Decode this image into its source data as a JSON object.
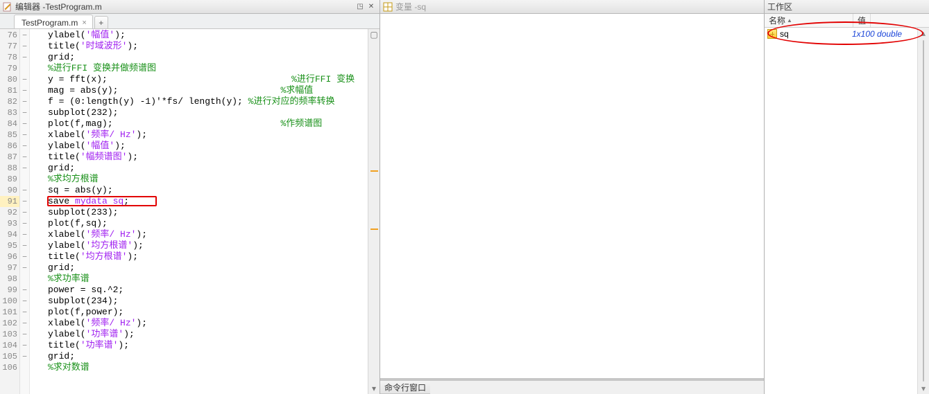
{
  "editor": {
    "title_prefix": "编辑器 - ",
    "title_file": "TestProgram.m",
    "tab_label": "TestProgram.m",
    "lines": [
      {
        "n": 76,
        "fold": true,
        "segs": [
          [
            "",
            "ylabel("
          ],
          [
            "str",
            "'幅值'"
          ],
          [
            "",
            ");"
          ]
        ]
      },
      {
        "n": 77,
        "fold": true,
        "segs": [
          [
            "",
            "title("
          ],
          [
            "str",
            "'时域波形'"
          ],
          [
            "",
            ");"
          ]
        ]
      },
      {
        "n": 78,
        "fold": true,
        "segs": [
          [
            "",
            "grid;"
          ]
        ]
      },
      {
        "n": 79,
        "fold": false,
        "segs": [
          [
            "cmt",
            "%进行FFI 变换并做频谱图"
          ]
        ]
      },
      {
        "n": 80,
        "fold": true,
        "segs": [
          [
            "",
            "y = fft(x);                                  "
          ],
          [
            "cmt",
            "%进行FFI 变换"
          ]
        ]
      },
      {
        "n": 81,
        "fold": true,
        "segs": [
          [
            "",
            "mag = abs(y);                              "
          ],
          [
            "cmt",
            "%求幅值"
          ]
        ]
      },
      {
        "n": 82,
        "fold": true,
        "segs": [
          [
            "",
            "f = (0:length(y) -1)'*fs/ length(y); "
          ],
          [
            "cmt",
            "%进行对应的频率转换"
          ]
        ]
      },
      {
        "n": 83,
        "fold": true,
        "segs": [
          [
            "",
            "subplot(232);"
          ]
        ]
      },
      {
        "n": 84,
        "fold": true,
        "segs": [
          [
            "",
            "plot(f,mag);                               "
          ],
          [
            "cmt",
            "%作频谱图"
          ]
        ]
      },
      {
        "n": 85,
        "fold": true,
        "segs": [
          [
            "",
            "xlabel("
          ],
          [
            "str",
            "'频率/ Hz'"
          ],
          [
            "",
            ");"
          ]
        ]
      },
      {
        "n": 86,
        "fold": true,
        "segs": [
          [
            "",
            "ylabel("
          ],
          [
            "str",
            "'幅值'"
          ],
          [
            "",
            ");"
          ]
        ]
      },
      {
        "n": 87,
        "fold": true,
        "segs": [
          [
            "",
            "title("
          ],
          [
            "str",
            "'幅频谱图'"
          ],
          [
            "",
            ");"
          ]
        ]
      },
      {
        "n": 88,
        "fold": true,
        "segs": [
          [
            "",
            "grid;"
          ]
        ]
      },
      {
        "n": 89,
        "fold": false,
        "segs": [
          [
            "cmt",
            "%求均方根谱"
          ]
        ]
      },
      {
        "n": 90,
        "fold": true,
        "segs": [
          [
            "",
            "sq = abs(y);"
          ]
        ]
      },
      {
        "n": 91,
        "fold": true,
        "segs": [
          [
            "",
            "save "
          ],
          [
            "str",
            "mydata sq"
          ],
          [
            "",
            ";"
          ]
        ]
      },
      {
        "n": 92,
        "fold": true,
        "segs": [
          [
            "",
            "subplot(233);"
          ]
        ]
      },
      {
        "n": 93,
        "fold": true,
        "segs": [
          [
            "",
            "plot(f,sq);"
          ]
        ]
      },
      {
        "n": 94,
        "fold": true,
        "segs": [
          [
            "",
            "xlabel("
          ],
          [
            "str",
            "'频率/ Hz'"
          ],
          [
            "",
            ");"
          ]
        ]
      },
      {
        "n": 95,
        "fold": true,
        "segs": [
          [
            "",
            "ylabel("
          ],
          [
            "str",
            "'均方根谱'"
          ],
          [
            "",
            ");"
          ]
        ]
      },
      {
        "n": 96,
        "fold": true,
        "segs": [
          [
            "",
            "title("
          ],
          [
            "str",
            "'均方根谱'"
          ],
          [
            "",
            ");"
          ]
        ]
      },
      {
        "n": 97,
        "fold": true,
        "segs": [
          [
            "",
            "grid;"
          ]
        ]
      },
      {
        "n": 98,
        "fold": false,
        "segs": [
          [
            "cmt",
            "%求功率谱"
          ]
        ]
      },
      {
        "n": 99,
        "fold": true,
        "segs": [
          [
            "",
            "power = sq.^2;"
          ]
        ]
      },
      {
        "n": 100,
        "fold": true,
        "segs": [
          [
            "",
            "subplot(234);"
          ]
        ]
      },
      {
        "n": 101,
        "fold": true,
        "segs": [
          [
            "",
            "plot(f,power);"
          ]
        ]
      },
      {
        "n": 102,
        "fold": true,
        "segs": [
          [
            "",
            "xlabel("
          ],
          [
            "str",
            "'频率/ Hz'"
          ],
          [
            "",
            ");"
          ]
        ]
      },
      {
        "n": 103,
        "fold": true,
        "segs": [
          [
            "",
            "ylabel("
          ],
          [
            "str",
            "'功率谱'"
          ],
          [
            "",
            ");"
          ]
        ]
      },
      {
        "n": 104,
        "fold": true,
        "segs": [
          [
            "",
            "title("
          ],
          [
            "str",
            "'功率谱'"
          ],
          [
            "",
            ");"
          ]
        ]
      },
      {
        "n": 105,
        "fold": true,
        "segs": [
          [
            "",
            "grid;"
          ]
        ]
      },
      {
        "n": 106,
        "fold": false,
        "segs": [
          [
            "cmt",
            "%求对数谱"
          ]
        ]
      }
    ]
  },
  "variables_panel": {
    "title_prefix": "变量 - ",
    "title_var": "sq"
  },
  "workspace": {
    "title": "工作区",
    "col_name": "名称",
    "col_value": "值",
    "rows": [
      {
        "name": "sq",
        "value": "1x100 double"
      }
    ]
  },
  "command_window": {
    "title": "命令行窗口"
  }
}
